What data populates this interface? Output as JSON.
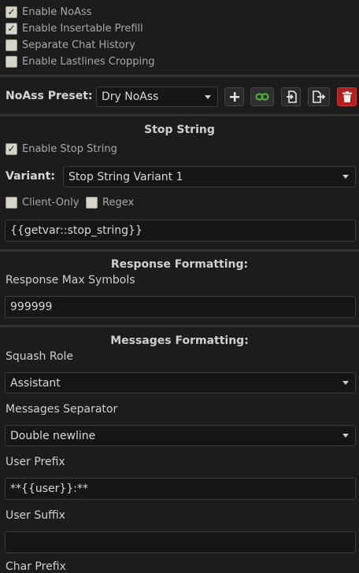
{
  "options": [
    {
      "label": "Enable NoAss",
      "checked": true
    },
    {
      "label": "Enable Insertable Prefill",
      "checked": true
    },
    {
      "label": "Separate Chat History",
      "checked": false
    },
    {
      "label": "Enable Lastlines Cropping",
      "checked": false
    }
  ],
  "preset": {
    "label": "NoAss Preset:",
    "value": "Dry NoAss",
    "buttons": [
      "plus-icon",
      "link-icon",
      "import-icon",
      "export-icon",
      "trash-icon"
    ],
    "link_color": "#4caf3c",
    "delete_color": "#b21f1f"
  },
  "stop_string": {
    "title": "Stop String",
    "enable_label": "Enable Stop String",
    "enable_checked": true,
    "variant_label": "Variant:",
    "variant_value": "Stop String Variant 1",
    "client_only_label": "Client-Only",
    "client_only_checked": false,
    "regex_label": "Regex",
    "regex_checked": false,
    "value": "{{getvar::stop_string}}"
  },
  "response": {
    "title": "Response Formatting:",
    "max_symbols_label": "Response Max Symbols",
    "max_symbols_value": "999999"
  },
  "messages": {
    "title": "Messages Formatting:",
    "squash_role_label": "Squash Role",
    "squash_role_value": "Assistant",
    "separator_label": "Messages Separator",
    "separator_value": "Double newline",
    "user_prefix_label": "User Prefix",
    "user_prefix_value": "**{{user}}:**",
    "user_suffix_label": "User Suffix",
    "user_suffix_value": "",
    "char_prefix_label": "Char Prefix"
  }
}
